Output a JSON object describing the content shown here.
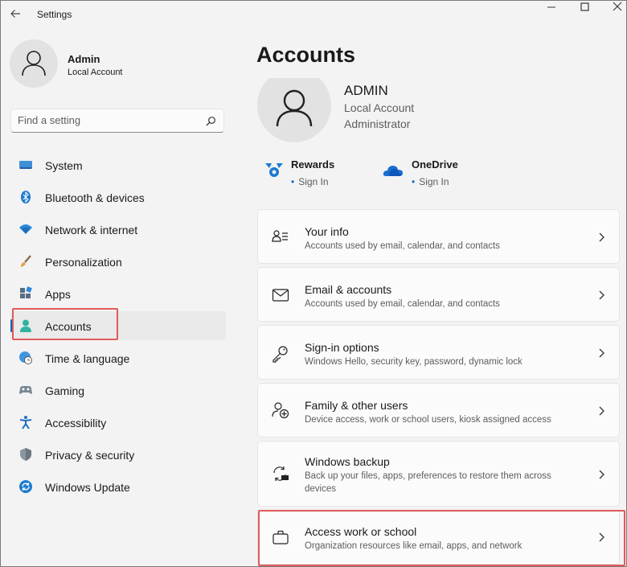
{
  "window": {
    "title": "Settings",
    "icons": [
      "back-arrow-icon",
      "minimize-icon",
      "maximize-icon",
      "close-icon"
    ]
  },
  "user": {
    "name": "Admin",
    "account_type": "Local Account"
  },
  "search": {
    "placeholder": "Find a setting"
  },
  "sidebar": {
    "items": [
      {
        "label": "System",
        "icon": "system-display-icon",
        "selected": false
      },
      {
        "label": "Bluetooth & devices",
        "icon": "bluetooth-icon",
        "selected": false
      },
      {
        "label": "Network & internet",
        "icon": "wifi-icon",
        "selected": false
      },
      {
        "label": "Personalization",
        "icon": "brush-icon",
        "selected": false
      },
      {
        "label": "Apps",
        "icon": "apps-icon",
        "selected": false
      },
      {
        "label": "Accounts",
        "icon": "accounts-icon",
        "selected": true
      },
      {
        "label": "Time & language",
        "icon": "globe-clock-icon",
        "selected": false
      },
      {
        "label": "Gaming",
        "icon": "gamepad-icon",
        "selected": false
      },
      {
        "label": "Accessibility",
        "icon": "accessibility-icon",
        "selected": false
      },
      {
        "label": "Privacy & security",
        "icon": "shield-icon",
        "selected": false
      },
      {
        "label": "Windows Update",
        "icon": "update-icon",
        "selected": false
      }
    ]
  },
  "main": {
    "title": "Accounts",
    "account": {
      "name": "ADMIN",
      "type": "Local Account",
      "role": "Administrator"
    },
    "services": [
      {
        "name": "Rewards",
        "status": "Sign In",
        "icon": "rewards-icon"
      },
      {
        "name": "OneDrive",
        "status": "Sign In",
        "icon": "onedrive-cloud-icon"
      }
    ],
    "cards": [
      {
        "title": "Your info",
        "description": "Accounts used by email, calendar, and contacts",
        "icon": "person-info-icon"
      },
      {
        "title": "Email & accounts",
        "description": "Accounts used by email, calendar, and contacts",
        "icon": "mail-icon"
      },
      {
        "title": "Sign-in options",
        "description": "Windows Hello, security key, password, dynamic lock",
        "icon": "key-icon"
      },
      {
        "title": "Family & other users",
        "description": "Device access, work or school users, kiosk assigned access",
        "icon": "family-add-icon"
      },
      {
        "title": "Windows backup",
        "description": "Back up your files, apps, preferences to restore them across devices",
        "icon": "backup-icon"
      },
      {
        "title": "Access work or school",
        "description": "Organization resources like email, apps, and network",
        "icon": "briefcase-icon"
      }
    ]
  },
  "colors": {
    "accent": "#0067c0",
    "highlight": "#e05a5a",
    "background": "#f3f3f3",
    "card": "#fbfbfb"
  }
}
